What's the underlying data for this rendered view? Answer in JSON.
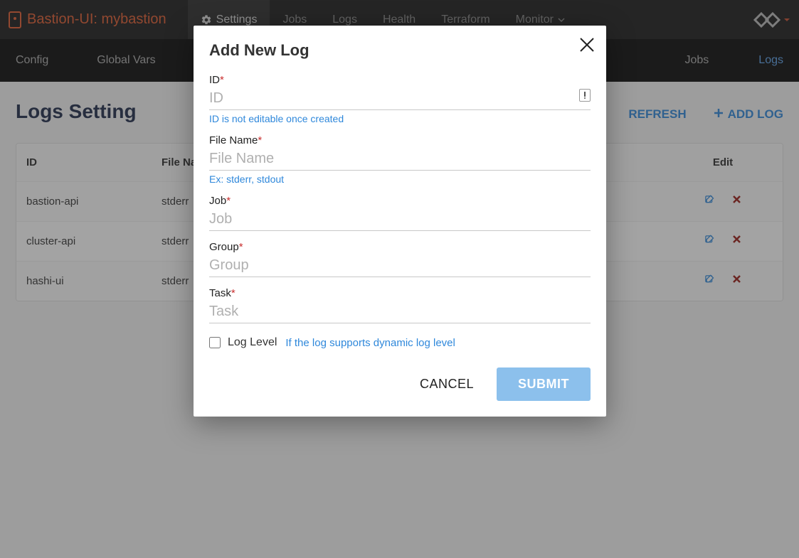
{
  "brand": {
    "title": "Bastion-UI: mybastion"
  },
  "topnav": {
    "items": [
      {
        "label": "Settings",
        "active": true,
        "icon": "gear-icon"
      },
      {
        "label": "Jobs"
      },
      {
        "label": "Logs"
      },
      {
        "label": "Health"
      },
      {
        "label": "Terraform"
      },
      {
        "label": "Monitor",
        "dropdown": true
      }
    ]
  },
  "subnav": {
    "left": [
      {
        "label": "Config"
      },
      {
        "label": "Global Vars"
      }
    ],
    "right": [
      {
        "label": "Jobs"
      },
      {
        "label": "Logs",
        "active": true
      }
    ]
  },
  "page": {
    "title": "Logs Setting",
    "actions": {
      "refresh": "REFRESH",
      "add_log": "ADD LOG"
    }
  },
  "table": {
    "headers": {
      "id": "ID",
      "file_name": "File Name",
      "edit": "Edit"
    },
    "rows": [
      {
        "id": "bastion-api",
        "file_name": "stderr"
      },
      {
        "id": "cluster-api",
        "file_name": "stderr"
      },
      {
        "id": "hashi-ui",
        "file_name": "stderr"
      }
    ]
  },
  "dialog": {
    "title": "Add New Log",
    "fields": {
      "id": {
        "label": "ID",
        "placeholder": "ID",
        "hint": "ID is not editable once created",
        "required": true
      },
      "file_name": {
        "label": "File Name",
        "placeholder": "File Name",
        "hint": "Ex: stderr, stdout",
        "required": true
      },
      "job": {
        "label": "Job",
        "placeholder": "Job",
        "required": true
      },
      "group": {
        "label": "Group",
        "placeholder": "Group",
        "required": true
      },
      "task": {
        "label": "Task",
        "placeholder": "Task",
        "required": true
      }
    },
    "log_level": {
      "label": "Log Level",
      "hint": "If the log supports dynamic log level",
      "checked": false
    },
    "actions": {
      "cancel": "CANCEL",
      "submit": "SUBMIT"
    }
  }
}
